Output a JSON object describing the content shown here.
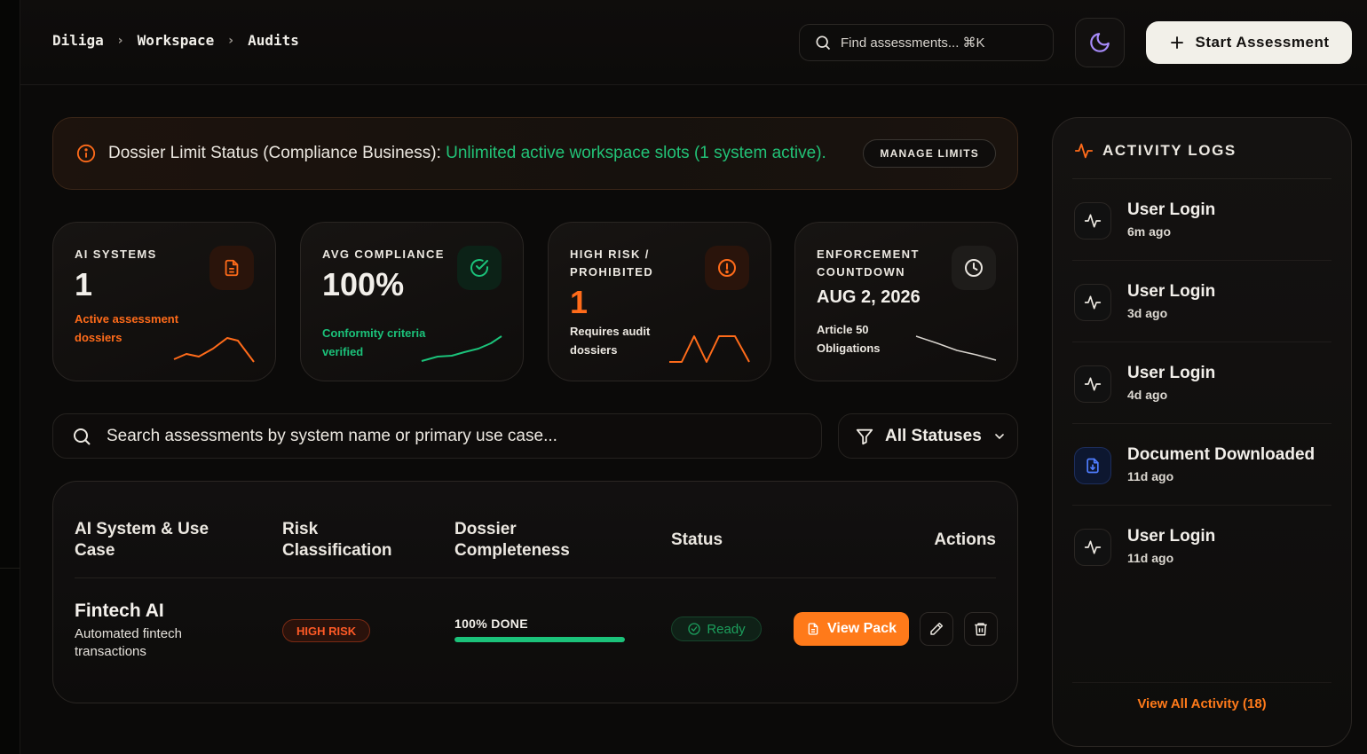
{
  "breadcrumb": [
    "Diliga",
    "Workspace",
    "Audits"
  ],
  "search": {
    "placeholder": "Find assessments... ⌘K"
  },
  "start_button": "Start Assessment",
  "banner": {
    "prefix": "Dossier Limit Status (Compliance Business):",
    "highlight": "Unlimited active workspace slots (1 system active).",
    "manage_label": "MANAGE LIMITS"
  },
  "stats": [
    {
      "label": "AI SYSTEMS",
      "value": "1",
      "sub": "Active assessment dossiers",
      "icon": "file-icon",
      "accent": "#ff6b1a"
    },
    {
      "label": "AVG COMPLIANCE",
      "value": "100%",
      "sub": "Conformity criteria verified",
      "icon": "check-circle-icon",
      "accent": "#1bc27a"
    },
    {
      "label": "HIGH RISK / PROHIBITED",
      "value": "1",
      "sub": "Requires audit dossiers",
      "icon": "alert-icon",
      "accent": "#ff6b1a"
    },
    {
      "label": "ENFORCEMENT COUNTDOWN",
      "value": "AUG 2, 2026",
      "sub": "Article 50 Obligations",
      "icon": "clock-icon",
      "accent": "#e8e4de"
    }
  ],
  "filter": {
    "search_placeholder": "Search assessments by system name or primary use case...",
    "status_label": "All Statuses"
  },
  "table": {
    "headers": [
      "AI System & Use Case",
      "Risk Classification",
      "Dossier Completeness",
      "Status",
      "Actions"
    ],
    "rows": [
      {
        "name": "Fintech AI",
        "description": "Automated fintech transactions",
        "risk": "HIGH RISK",
        "completeness_label": "100% DONE",
        "completeness": 1.0,
        "status": "Ready",
        "view_label": "View Pack"
      }
    ]
  },
  "activity": {
    "title": "ACTIVITY LOGS",
    "items": [
      {
        "name": "User Login",
        "time": "6m ago",
        "icon": "activity-icon"
      },
      {
        "name": "User Login",
        "time": "3d ago",
        "icon": "activity-icon"
      },
      {
        "name": "User Login",
        "time": "4d ago",
        "icon": "activity-icon"
      },
      {
        "name": "Document Downloaded",
        "time": "11d ago",
        "icon": "document-download-icon"
      },
      {
        "name": "User Login",
        "time": "11d ago",
        "icon": "activity-icon"
      }
    ],
    "view_all": "View All Activity (18)"
  },
  "colors": {
    "accent": "#ff7a1a",
    "success": "#1bc27a",
    "danger": "#ff5a26"
  }
}
